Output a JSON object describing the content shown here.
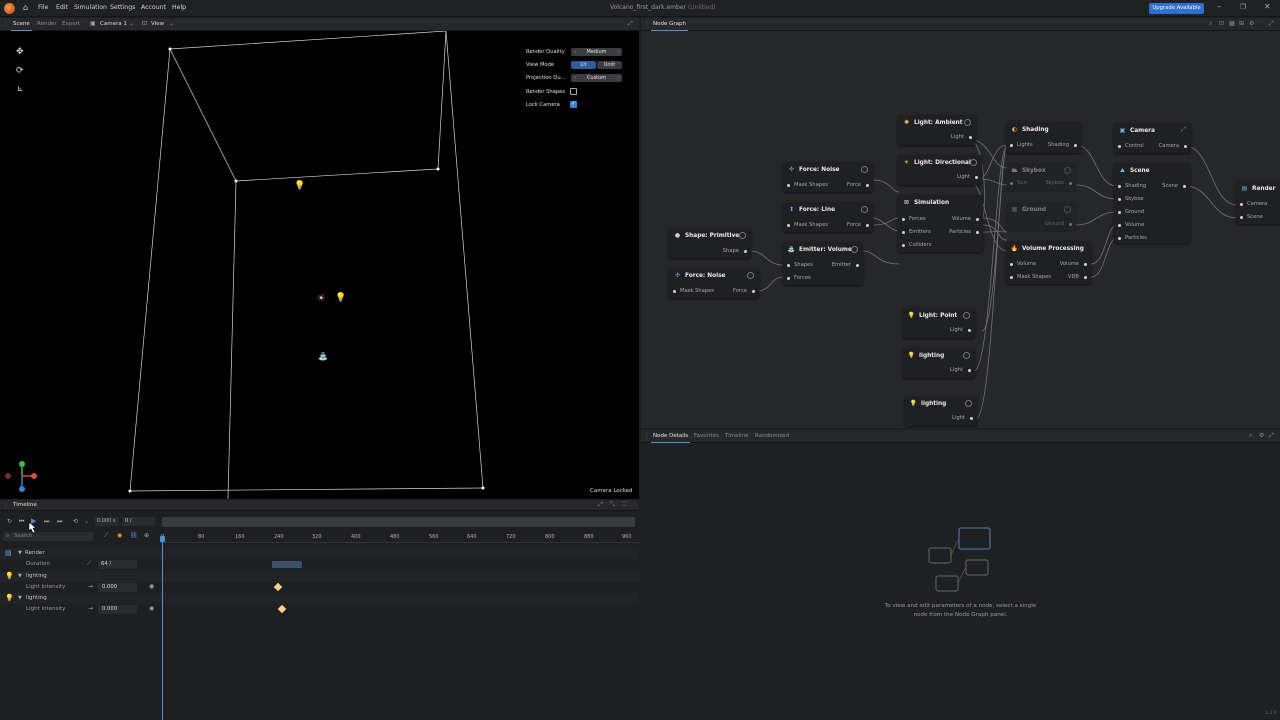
{
  "app": {
    "title": "Volcano_first_dark.ember",
    "title_status": "(Unlitled)",
    "upgrade_label": "Upgrade Available",
    "version": "1.3.0"
  },
  "menu": [
    "File",
    "Edit",
    "Simulation",
    "Settings",
    "Account",
    "Help"
  ],
  "scene": {
    "tabs": [
      "Scene",
      "Render",
      "Export"
    ],
    "camera_select": "Camera 1",
    "view_select": "View",
    "render_quality_label": "Render Quality",
    "render_quality_value": "Medium",
    "view_mode_label": "View Mode",
    "view_mode_options": [
      "Lit",
      "Unlit"
    ],
    "view_mode_selected": "Lit",
    "projection_label": "Projection Qu...",
    "projection_value": "Custom",
    "render_shapes_label": "Render Shapes",
    "render_shapes_checked": false,
    "lock_camera_label": "Lock Camera",
    "lock_camera_checked": true,
    "camera_locked_text": "Camera Locked"
  },
  "node_graph": {
    "tab": "Node Graph",
    "nodes": {
      "light_ambient": {
        "title": "Light: Ambient",
        "out": "Light"
      },
      "shading": {
        "title": "Shading",
        "in": "Lights",
        "out": "Shading"
      },
      "camera": {
        "title": "Camera",
        "in": "Control",
        "out": "Camera"
      },
      "force_noise_1": {
        "title": "Force: Noise",
        "in": "Mask Shapes",
        "out": "Force"
      },
      "light_directional": {
        "title": "Light: Directional",
        "out": "Light"
      },
      "skybox": {
        "title": "Skybox",
        "in": "Sun",
        "out": "Skybox"
      },
      "scene": {
        "title": "Scene",
        "in": [
          "Shading",
          "Skybox",
          "Ground",
          "Volume",
          "Particles"
        ],
        "out": "Scene"
      },
      "render": {
        "title": "Render",
        "in": [
          "Camera",
          "Scene"
        ]
      },
      "force_line": {
        "title": "Force: Line",
        "in": "Mask Shapes",
        "out": "Force"
      },
      "simulation": {
        "title": "Simulation",
        "in": [
          "Forces",
          "Emitters",
          "Colliders"
        ],
        "out": [
          "Volume",
          "Particles"
        ]
      },
      "ground": {
        "title": "Ground",
        "out": "Ground"
      },
      "shape_primitive": {
        "title": "Shape: Primitive",
        "out": "Shape"
      },
      "emitter_volume": {
        "title": "Emitter: Volume",
        "in": [
          "Shapes",
          "Forces"
        ],
        "out": "Emitter"
      },
      "volume_processing": {
        "title": "Volume Processing",
        "in": [
          "Volume",
          "Mask Shapes"
        ],
        "out": [
          "Volume",
          "VDB"
        ]
      },
      "force_noise_2": {
        "title": "Force: Noise",
        "in": "Mask Shapes",
        "out": "Force"
      },
      "light_point": {
        "title": "Light: Point",
        "out": "Light"
      },
      "lighting_1": {
        "title": "lighting",
        "out": "Light"
      },
      "lighting_2": {
        "title": "lighting",
        "out": "Light"
      }
    }
  },
  "details": {
    "tabs": [
      "Node Details",
      "Favorites",
      "Timeline",
      "Randomized"
    ],
    "empty_message_line1": "To view and edit parameters of a node, select a single",
    "empty_message_line2": "node from the Node Graph panel."
  },
  "timeline": {
    "title": "Timeline",
    "time_value": "0.000 s",
    "frame_value": "0 /",
    "search_placeholder": "Search",
    "ruler": [
      "0",
      "80",
      "160",
      "240",
      "320",
      "400",
      "480",
      "560",
      "640",
      "720",
      "800",
      "880",
      "960"
    ],
    "rows": {
      "render": "Render",
      "duration_label": "Duration",
      "duration_value": "64 /",
      "lighting_1": "lighting",
      "light_intensity_1_label": "Light Intensity",
      "light_intensity_1_value": "0.000",
      "lighting_2": "lighting",
      "light_intensity_2_label": "Light Intensity",
      "light_intensity_2_value": "0.000"
    }
  }
}
